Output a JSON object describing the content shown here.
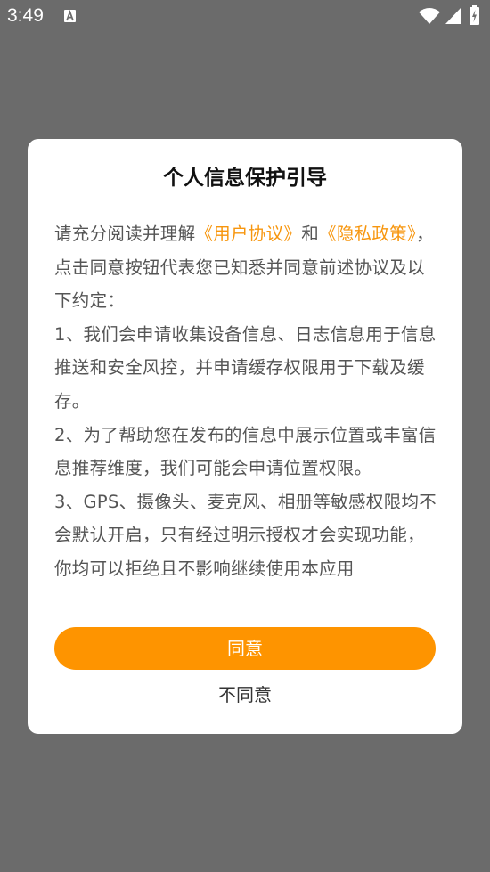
{
  "status_bar": {
    "time": "3:49",
    "icons": [
      "a-notification-icon",
      "wifi-icon",
      "signal-icon",
      "battery-icon"
    ]
  },
  "dialog": {
    "title": "个人信息保护引导",
    "intro_prefix": "请充分阅读并理解",
    "user_agreement_link": "《用户协议》",
    "and_text": "和",
    "privacy_policy_link": "《隐私政策》",
    "intro_suffix": "，点击同意按钮代表您已知悉并同意前述协议及以下约定：",
    "items": [
      "1、我们会申请收集设备信息、日志信息用于信息推送和安全风控，并申请缓存权限用于下载及缓存。",
      "2、为了帮助您在发布的信息中展示位置或丰富信息推荐维度，我们可能会申请位置权限。",
      "3、GPS、摄像头、麦克风、相册等敏感权限均不会默认开启，只有经过明示授权才会实现功能，你均可以拒绝且不影响继续使用本应用"
    ],
    "agree_label": "同意",
    "disagree_label": "不同意"
  },
  "colors": {
    "overlay": "#6b6b6b",
    "accent": "#fe9400",
    "link": "#f7960e"
  }
}
